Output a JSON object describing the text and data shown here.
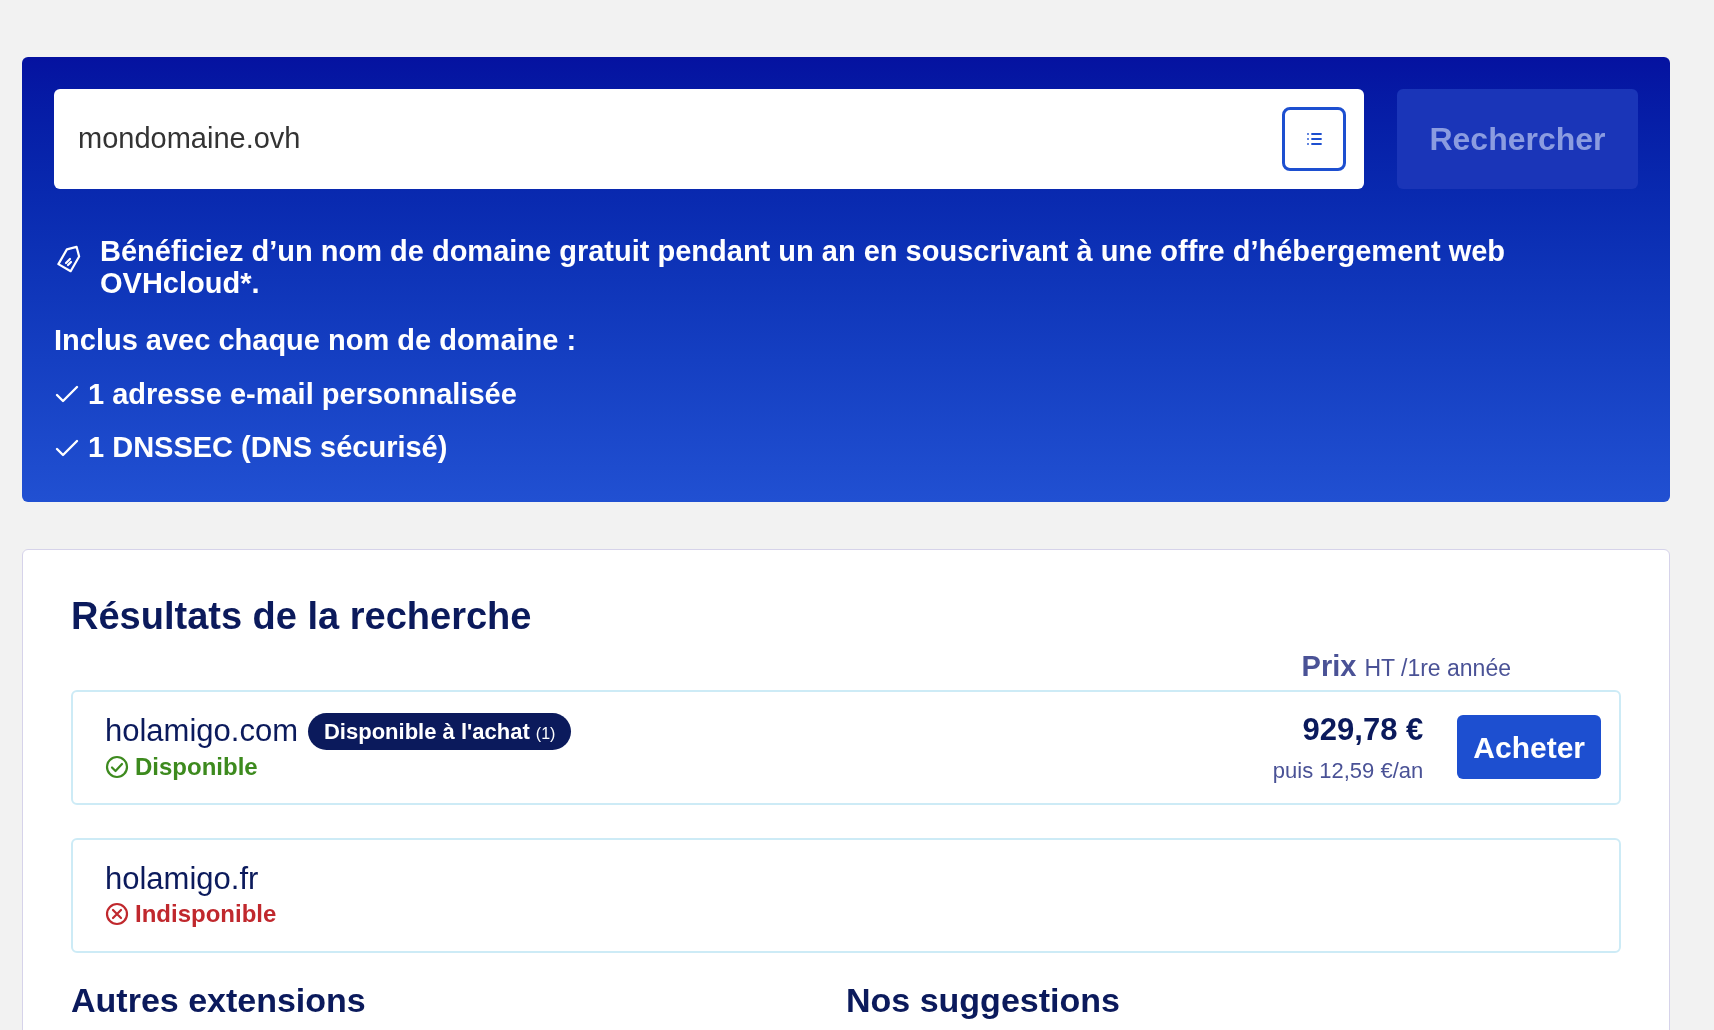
{
  "search": {
    "value": "mondomaine.ovh",
    "button": "Rechercher",
    "button_disabled": true
  },
  "promo": {
    "text": "Bénéficiez d’un nom de domaine gratuit pendant un an en souscrivant à une offre d’hébergement web OVHcloud*.",
    "included_title": "Inclus avec chaque nom de domaine :",
    "included": [
      "1 adresse e-mail personnalisée",
      "1 DNSSEC (DNS sécurisé)"
    ]
  },
  "results": {
    "title": "Résultats de la recherche",
    "price_header": {
      "label": "Prix",
      "note": "HT /1re année"
    },
    "rows": [
      {
        "domain": "holamigo.com",
        "kind": "available",
        "status": "Disponible",
        "badge": {
          "label": "Disponible à l'achat",
          "note": "(1)"
        },
        "price": "929,78 €",
        "renewal": "puis 12,59 €/an",
        "button": "Acheter"
      },
      {
        "domain": "holamigo.fr",
        "kind": "unavailable",
        "status": "Indisponible"
      }
    ]
  },
  "sections": [
    "Autres extensions",
    "Nos suggestions"
  ]
}
